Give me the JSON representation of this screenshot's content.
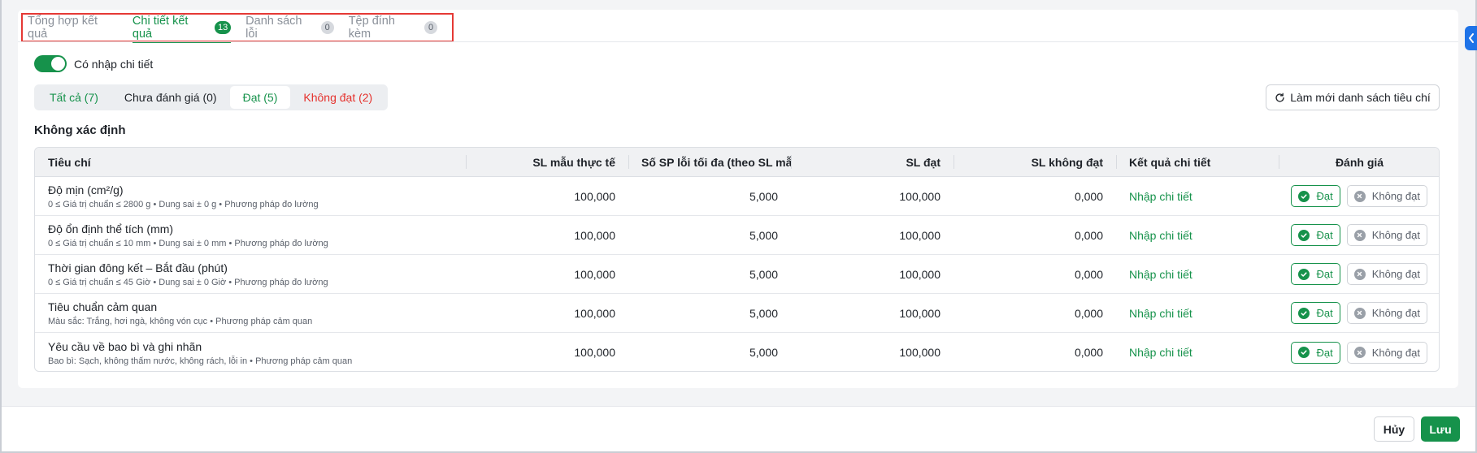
{
  "tabs": [
    {
      "label": "Tổng hợp kết quả",
      "badge": ""
    },
    {
      "label": "Chi tiết kết quả",
      "badge": "13"
    },
    {
      "label": "Danh sách lỗi",
      "badge": "0"
    },
    {
      "label": "Tệp đính kèm",
      "badge": "0"
    }
  ],
  "toggle": {
    "label": "Có nhập chi tiết",
    "on": true
  },
  "filters": {
    "all": "Tất cả (7)",
    "pending": "Chưa đánh giá (0)",
    "pass": "Đạt (5)",
    "fail": "Không đạt (2)"
  },
  "refresh_label": "Làm mới danh sách tiêu chí",
  "section_title": "Không xác định",
  "columns": {
    "criteria": "Tiêu chí",
    "sample_qty": "SL mẫu thực tế",
    "max_defect": "Số SP lỗi tối đa (theo SL mẫu)",
    "pass_qty": "SL đạt",
    "fail_qty": "SL không đạt",
    "detail_result": "Kết quả chi tiết",
    "evaluation": "Đánh giá"
  },
  "rows": [
    {
      "name": "Độ mịn (cm²/g)",
      "desc": "0 ≤ Giá trị chuẩn ≤ 2800 g • Dung sai ± 0 g • Phương pháp đo lường",
      "sample": "100,000",
      "max_defect": "5,000",
      "pass": "100,000",
      "fail": "0,000",
      "detail": "Nhập chi tiết"
    },
    {
      "name": "Độ ổn định thể tích (mm)",
      "desc": "0 ≤ Giá trị chuẩn ≤ 10 mm • Dung sai ± 0 mm • Phương pháp đo lường",
      "sample": "100,000",
      "max_defect": "5,000",
      "pass": "100,000",
      "fail": "0,000",
      "detail": "Nhập chi tiết"
    },
    {
      "name": "Thời gian đông kết – Bắt đầu (phút)",
      "desc": "0 ≤ Giá trị chuẩn ≤ 45 Giờ • Dung sai ± 0 Giờ • Phương pháp đo lường",
      "sample": "100,000",
      "max_defect": "5,000",
      "pass": "100,000",
      "fail": "0,000",
      "detail": "Nhập chi tiết"
    },
    {
      "name": "Tiêu chuẩn cảm quan",
      "desc": "Màu sắc: Trắng, hơi ngà, không vón cục • Phương pháp cảm quan",
      "sample": "100,000",
      "max_defect": "5,000",
      "pass": "100,000",
      "fail": "0,000",
      "detail": "Nhập chi tiết"
    },
    {
      "name": "Yêu cầu về bao bì và ghi nhãn",
      "desc": "Bao bì: Sạch, không thấm nước, không rách, lỗi in • Phương pháp cảm quan",
      "sample": "100,000",
      "max_defect": "5,000",
      "pass": "100,000",
      "fail": "0,000",
      "detail": "Nhập chi tiết"
    }
  ],
  "eval_labels": {
    "pass": "Đạt",
    "fail": "Không đạt"
  },
  "footer": {
    "cancel": "Hủy",
    "save": "Lưu"
  },
  "colors": {
    "primary": "#16924b",
    "danger": "#e5322d",
    "highlight_border": "#e53935",
    "side_handle": "#1e73e8"
  }
}
